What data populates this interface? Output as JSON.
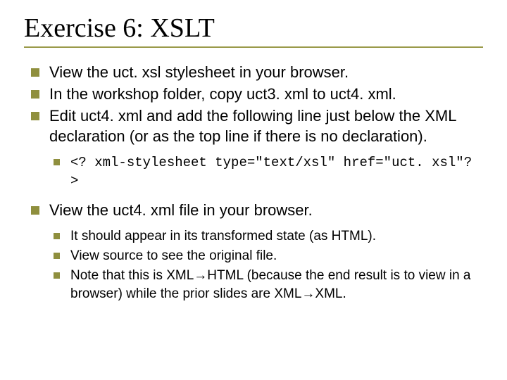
{
  "title": "Exercise 6: XSLT",
  "bullets": {
    "b1": "View the uct. xsl stylesheet in your browser.",
    "b2": "In the workshop folder, copy uct3. xml to uct4. xml.",
    "b3": "Edit uct4. xml and add the following line just below the XML declaration (or as the top line if there is no declaration).",
    "b3s1": "<? xml-stylesheet type=\"text/xsl\" href=\"uct. xsl\"? >",
    "b4": "View the uct4. xml file in your browser.",
    "b4s1": "It should appear in its transformed state (as HTML).",
    "b4s2": "View source to see the original file.",
    "b4s3": "Note that this is XML→HTML (because the end result is to view in a browser) while the prior slides are XML→XML."
  }
}
